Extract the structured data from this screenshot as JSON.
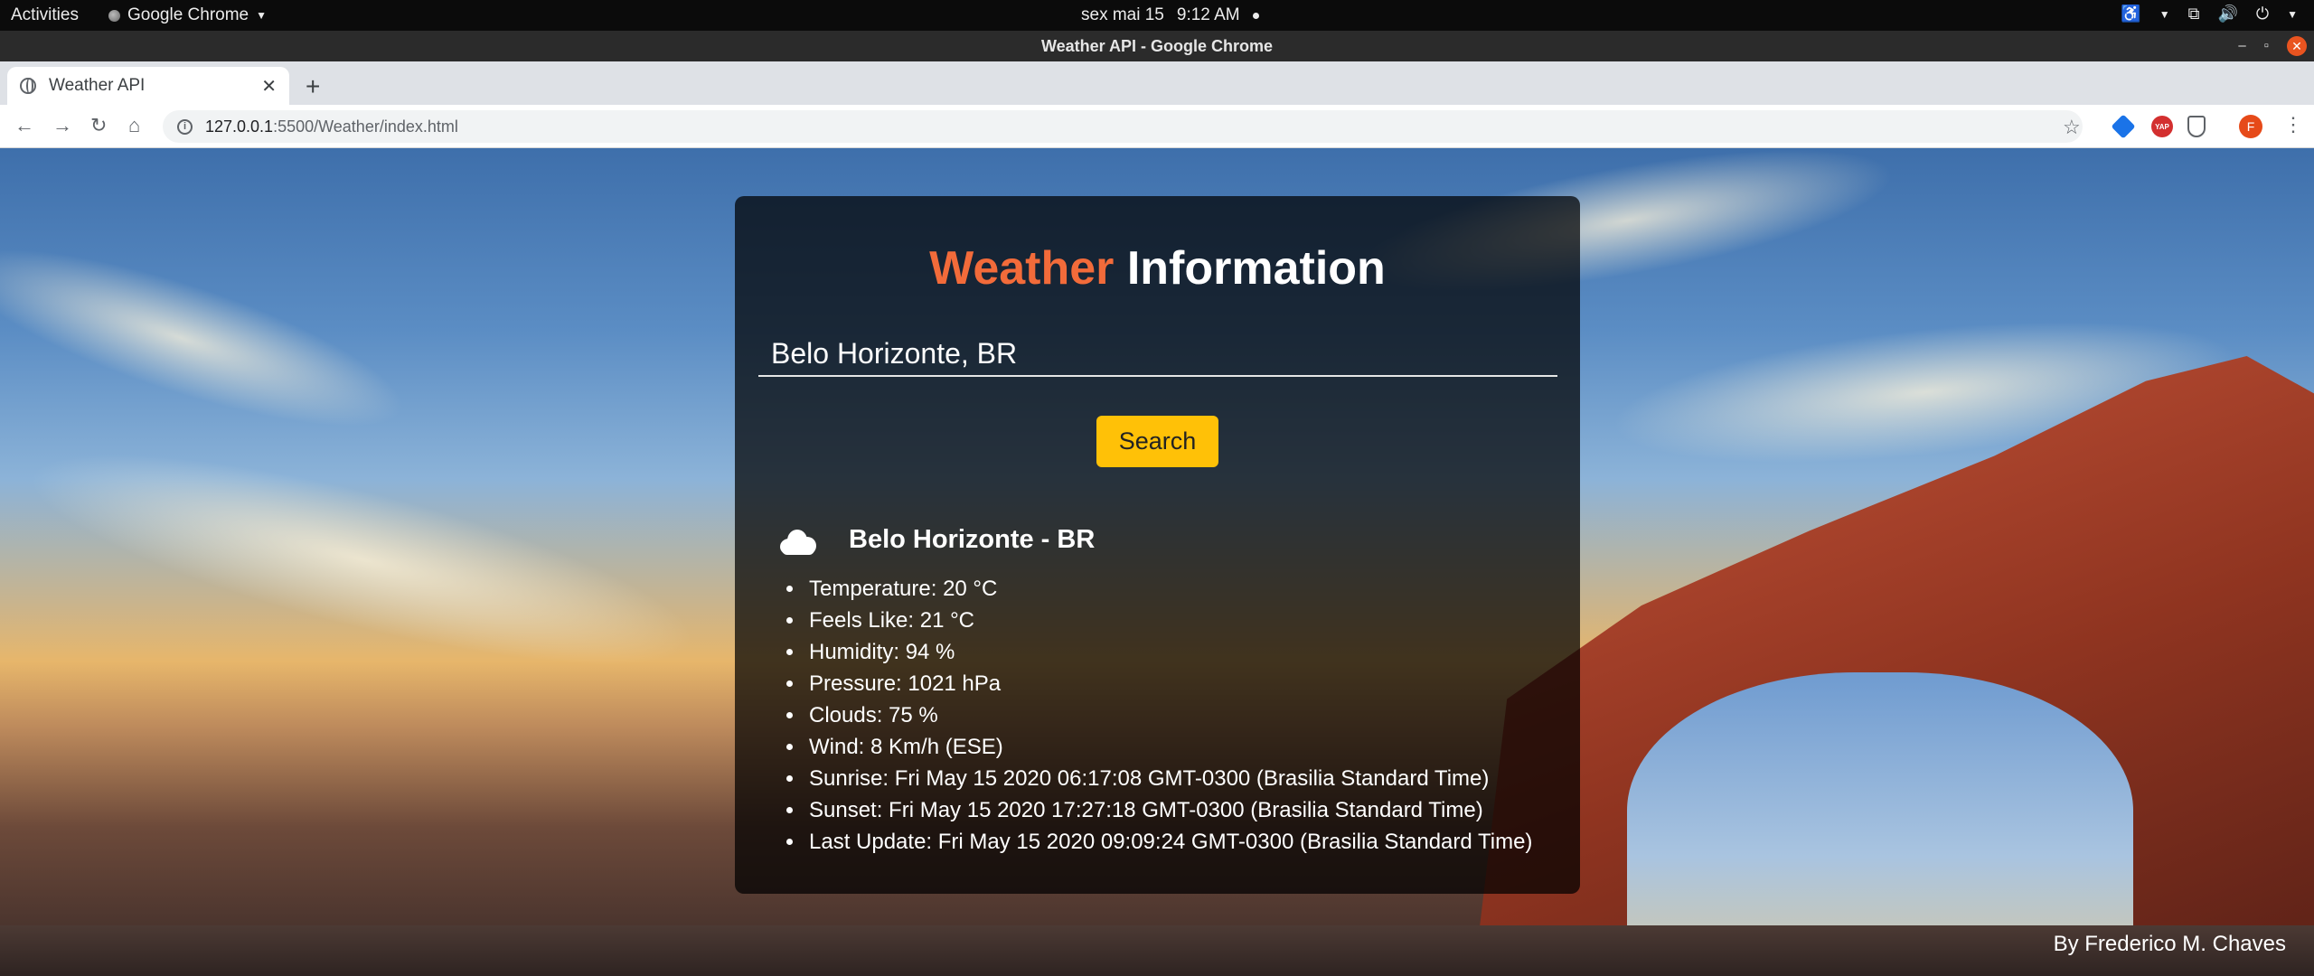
{
  "os": {
    "activities": "Activities",
    "app_menu": "Google Chrome",
    "clock_date": "sex mai 15",
    "clock_time": "9:12 AM"
  },
  "window": {
    "title": "Weather API - Google Chrome"
  },
  "browser": {
    "tab_title": "Weather API",
    "url_host": "127.0.0.1",
    "url_path": ":5500/Weather/index.html",
    "profile_initial": "F",
    "ext_badge": "YAP"
  },
  "app": {
    "heading_accent": "Weather",
    "heading_rest": " Information",
    "city_value": "Belo Horizonte, BR",
    "search_label": "Search",
    "weather_icon": "cloud-icon",
    "location": "Belo Horizonte - BR",
    "details": [
      "Temperature: 20 °C",
      "Feels Like: 21 °C",
      "Humidity: 94 %",
      "Pressure: 1021 hPa",
      "Clouds: 75 %",
      "Wind: 8 Km/h (ESE)",
      "Sunrise: Fri May 15 2020 06:17:08 GMT-0300 (Brasilia Standard Time)",
      "Sunset: Fri May 15 2020 17:27:18 GMT-0300 (Brasilia Standard Time)",
      "Last Update: Fri May 15 2020 09:09:24 GMT-0300 (Brasilia Standard Time)"
    ],
    "credit": "By Frederico M. Chaves"
  },
  "colors": {
    "accent": "#f26b3a",
    "button": "#ffc107"
  }
}
